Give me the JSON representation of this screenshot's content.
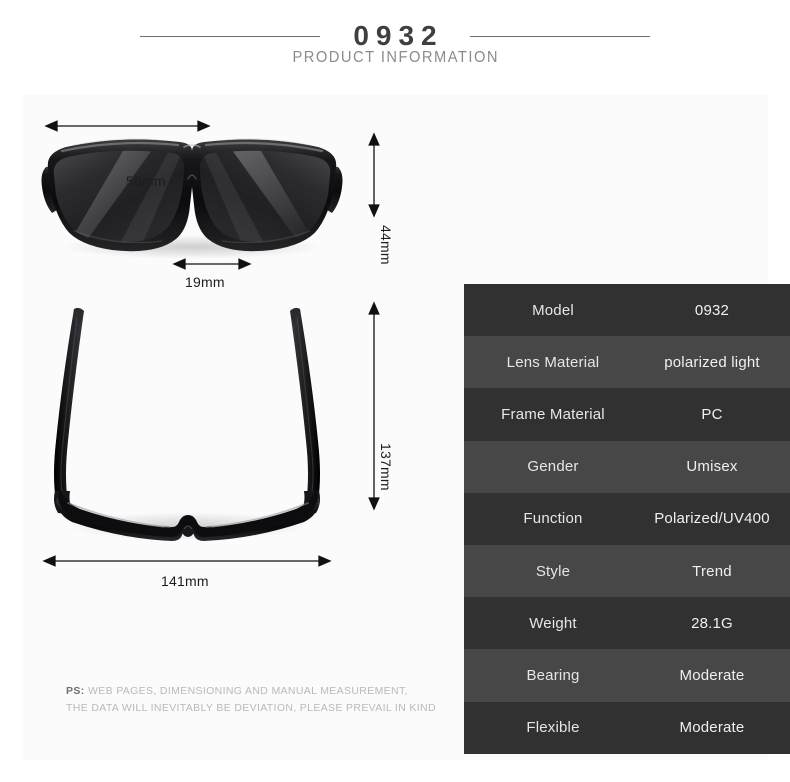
{
  "header": {
    "model_number": "0932",
    "subtitle": "PRODUCT INFORMATION"
  },
  "dimensions": {
    "front_lens_width": "56mm",
    "front_lens_height": "44mm",
    "bridge_width": "19mm",
    "temple_length": "137mm",
    "frame_total_width": "141mm"
  },
  "spec_table": {
    "rows": [
      {
        "key": "Model",
        "value": "0932"
      },
      {
        "key": "Lens Material",
        "value": "polarized light"
      },
      {
        "key": "Frame Material",
        "value": "PC"
      },
      {
        "key": "Gender",
        "value": "Umisex"
      },
      {
        "key": "Function",
        "value": "Polarized/UV400"
      },
      {
        "key": "Style",
        "value": "Trend"
      },
      {
        "key": "Weight",
        "value": "28.1G"
      },
      {
        "key": "Bearing",
        "value": "Moderate"
      },
      {
        "key": "Flexible",
        "value": "Moderate"
      }
    ]
  },
  "note": {
    "prefix": "PS:",
    "line1": "WEB PAGES, DIMENSIONING AND MANUAL MEASUREMENT,",
    "line2": "THE DATA WILL INEVITABLY BE DEVIATION, PLEASE PREVAIL IN KIND"
  },
  "colors": {
    "page_background": "#ffffff",
    "panel_background": "#fbfbfb",
    "row_dark": "#313131",
    "row_light": "#474747",
    "title_text": "#3f3f3f",
    "subtitle_text": "#8c8c8c",
    "dimension_text": "#1d1d1d",
    "note_text": "#b9b9b9",
    "frame_black": "#111111",
    "lens_black": "#2a2a2c"
  }
}
